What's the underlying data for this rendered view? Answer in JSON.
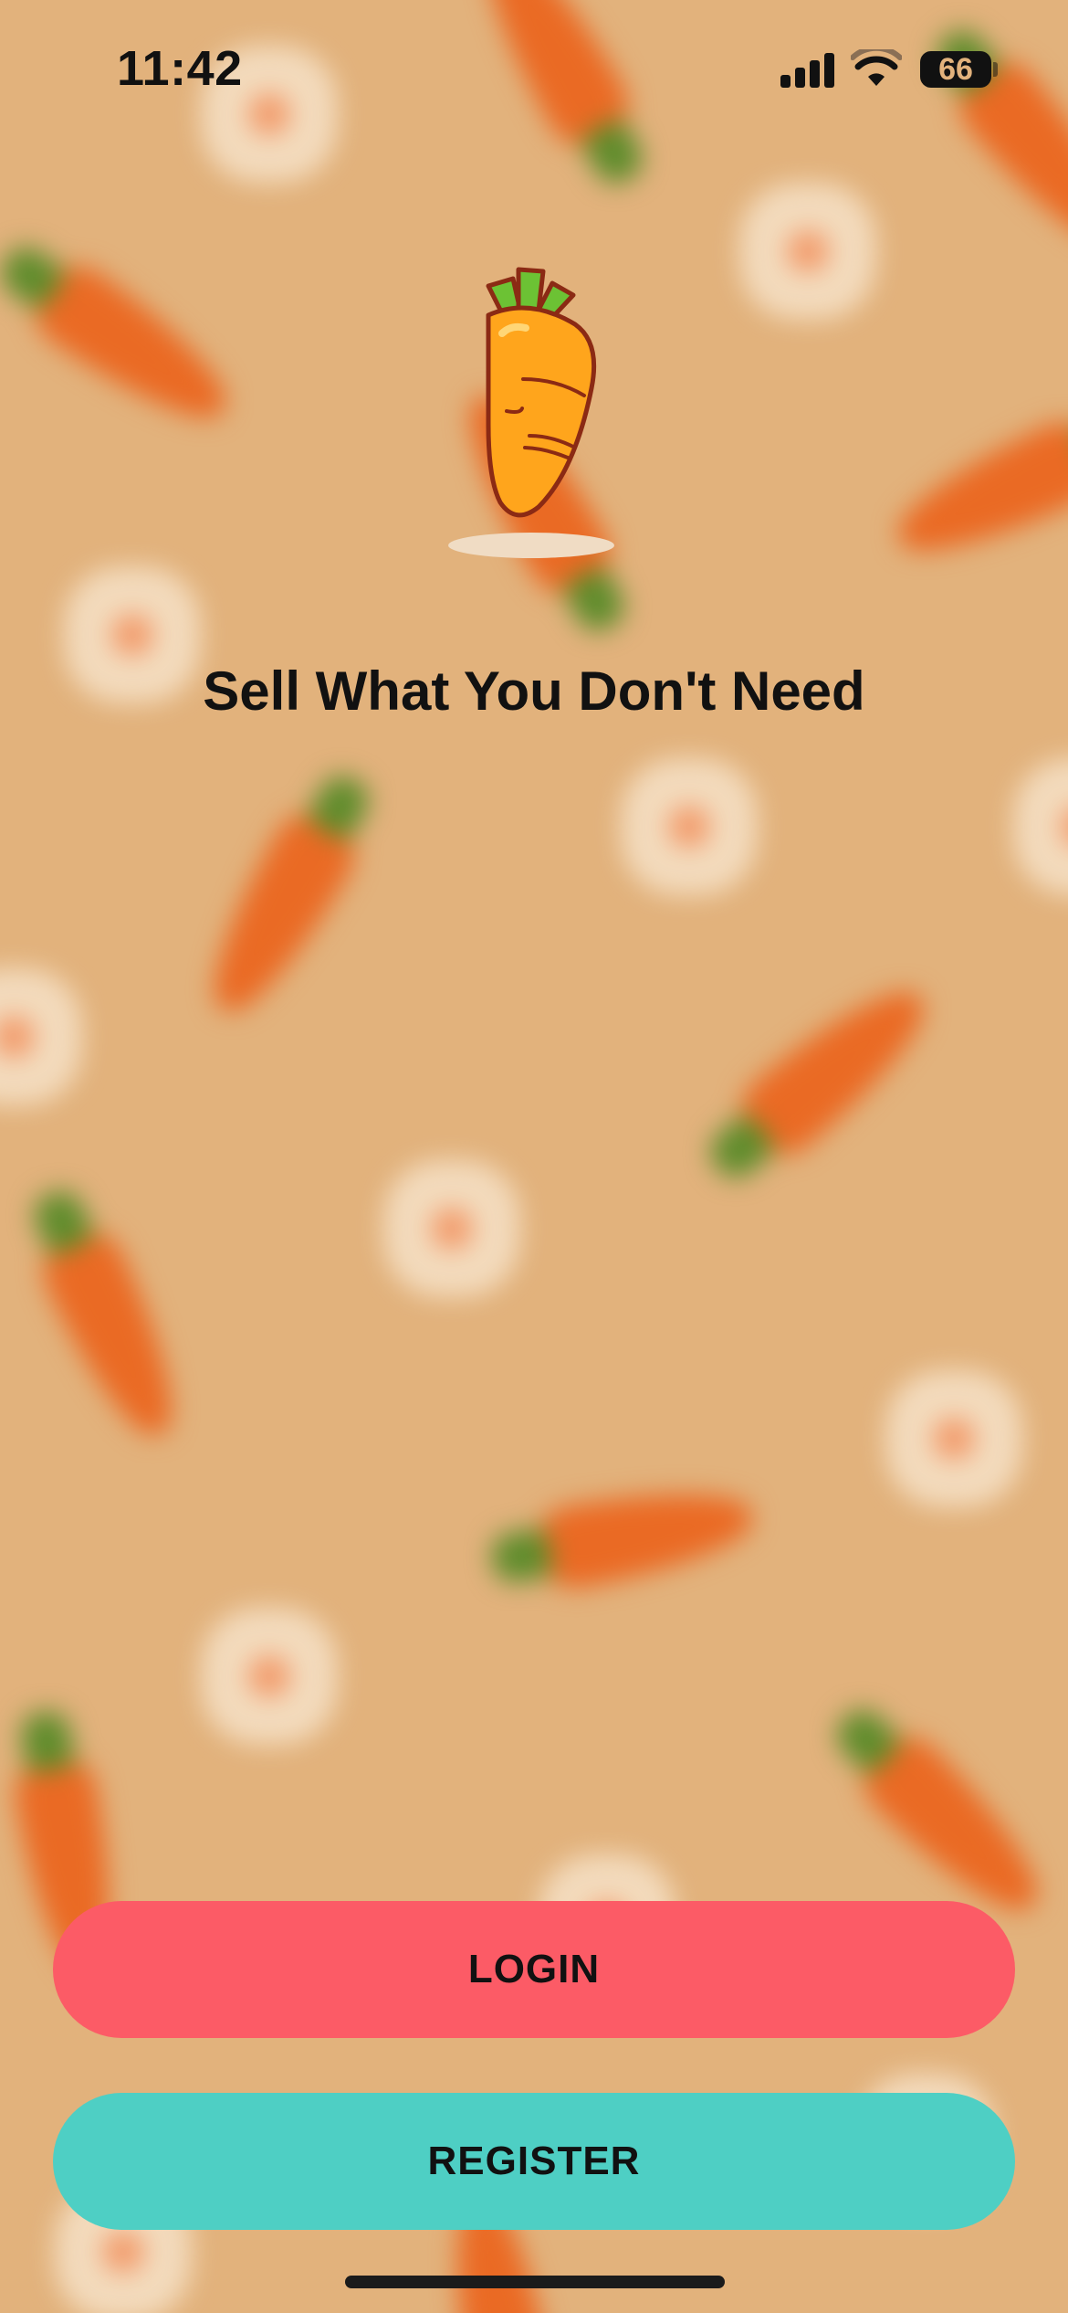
{
  "status_bar": {
    "time": "11:42",
    "battery_level": "66",
    "icons": [
      "cellular-signal-icon",
      "wifi-icon",
      "battery-icon"
    ]
  },
  "logo": {
    "icon": "carrot-icon"
  },
  "tagline": "Sell What You Don't Need",
  "buttons": {
    "login_label": "LOGIN",
    "register_label": "REGISTER"
  },
  "colors": {
    "background": "#e2b27c",
    "login_button": "#fc5b66",
    "register_button": "#4ecfc4",
    "text": "#111111",
    "carrot_body": "#ffa51c",
    "carrot_leaves": "#6cc234"
  }
}
